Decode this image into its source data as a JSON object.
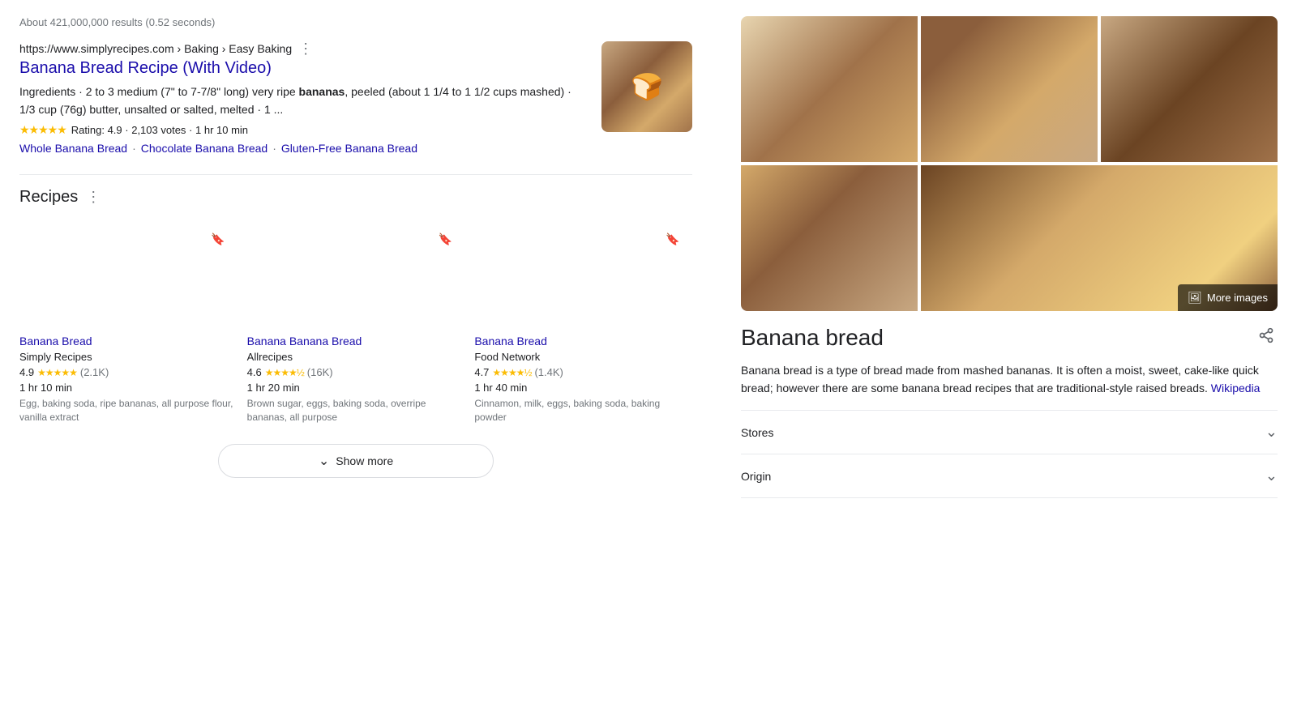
{
  "results_count": "About 421,000,000 results (0.52 seconds)",
  "main_result": {
    "url": "https://www.simplyrecipes.com",
    "breadcrumb": "Baking › Easy Baking",
    "title": "Banana Bread Recipe (With Video)",
    "snippet_parts": [
      "Ingredients · 2 to 3 medium (7\" to 7-7/8\" long) very ripe ",
      "bananas",
      ", peeled (about 1 1/4 to 1 1/2 cups mashed) · 1/3 cup (76g) butter, unsalted or salted, melted · 1 ..."
    ],
    "rating_value": "4.9",
    "rating_votes": "2,103 votes",
    "rating_time": "1 hr 10 min",
    "links": [
      {
        "text": "Whole Banana Bread",
        "label": "whole-banana-bread-link"
      },
      {
        "text": "Chocolate Banana Bread",
        "label": "chocolate-banana-bread-link"
      },
      {
        "text": "Gluten-Free Banana Bread",
        "label": "gluten-free-banana-bread-link"
      }
    ]
  },
  "recipes_section": {
    "title": "Recipes",
    "cards": [
      {
        "name": "Banana Bread",
        "source": "Simply Recipes",
        "rating": "4.9",
        "votes": "(2.1K)",
        "time": "1 hr 10 min",
        "ingredients": "Egg, baking soda, ripe bananas, all purpose flour, vanilla extract",
        "img_class": "recipe-img-1",
        "label": "recipe-card-1"
      },
      {
        "name": "Banana Banana Bread",
        "source": "Allrecipes",
        "rating": "4.6",
        "votes": "(16K)",
        "time": "1 hr 20 min",
        "ingredients": "Brown sugar, eggs, baking soda, overripe bananas, all purpose",
        "img_class": "recipe-img-2",
        "label": "recipe-card-2"
      },
      {
        "name": "Banana Bread",
        "source": "Food Network",
        "rating": "4.7",
        "votes": "(1.4K)",
        "time": "1 hr 40 min",
        "ingredients": "Cinnamon, milk, eggs, baking soda, baking powder",
        "img_class": "recipe-img-3",
        "label": "recipe-card-3"
      }
    ]
  },
  "show_more": "Show more",
  "sidebar": {
    "entity_title": "Banana bread",
    "description_text": "Banana bread is a type of bread made from mashed bananas. It is often a moist, sweet, cake-like quick bread; however there are some banana bread recipes that are traditional-style raised breads.",
    "wikipedia_label": "Wikipedia",
    "more_images_text": "More images",
    "accordion_items": [
      {
        "label": "Stores"
      },
      {
        "label": "Origin"
      }
    ]
  }
}
